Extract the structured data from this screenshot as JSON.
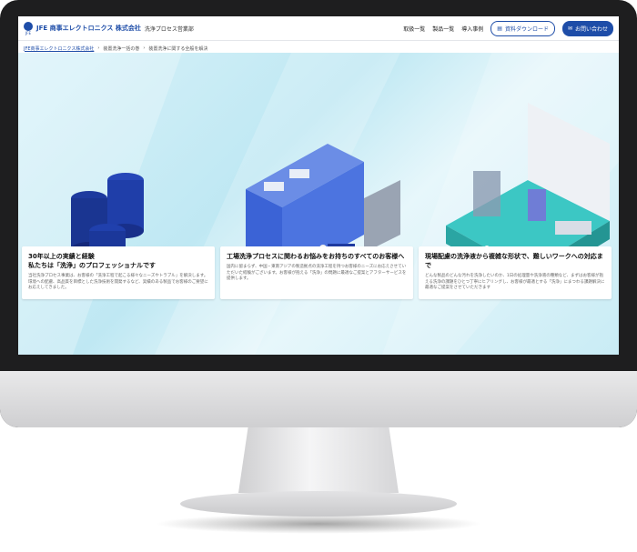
{
  "header": {
    "logo_sub": "JFE",
    "brand": "JFE 商事エレクトロニクス 株式会社",
    "department": "洗浄プロセス営業部",
    "nav": [
      "取扱一覧",
      "製品一覧",
      "導入事例"
    ],
    "download_label": "資料ダウンロード",
    "contact_label": "お問い合わせ"
  },
  "breadcrumb": [
    "JFE商事エレクトロニクス株式会社",
    "装置洗浄一括の巻",
    "装置洗浄に関する全般を解決"
  ],
  "cards": [
    {
      "title_lines": [
        "30年以上の実績と経験",
        "私たちは「洗浄」のプロフェッショナルです"
      ],
      "body": "当社洗浄プロセス事業は、お客様の「洗浄工程で起こる様々なニーズやトラブル」を解決します。環境への配慮、高品質を目標とした洗浄技術を開発するなど、実績のある製品でお客様のご要望にお応えしてきました。"
    },
    {
      "title_lines": [
        "工場洗浄プロセスに関わるお悩みをお持ちのすべてのお客様へ"
      ],
      "body": "国内に留まらず、中国・東南アジアの製造拠点の洗浄工程を持つお客様のニーズにお応えさせていただいた経験がございます。お客様が抱える「洗浄」の問題に最適なご提案とアフターサービスを提供します。"
    },
    {
      "title_lines": [
        "現場配慮の洗浄液から複雑な形状で、難しいワークへの対応まで"
      ],
      "body": "どんな製品のどんな汚れを洗浄したいのか、1日の処理量や洗浄液の種類など、まずはお客様が抱える洗浄の課題をひとつ丁寧にヒアリングし、お客様が最適とする「洗浄」にまつわる課題解決に最適なご提案をさせていただきます"
    }
  ]
}
